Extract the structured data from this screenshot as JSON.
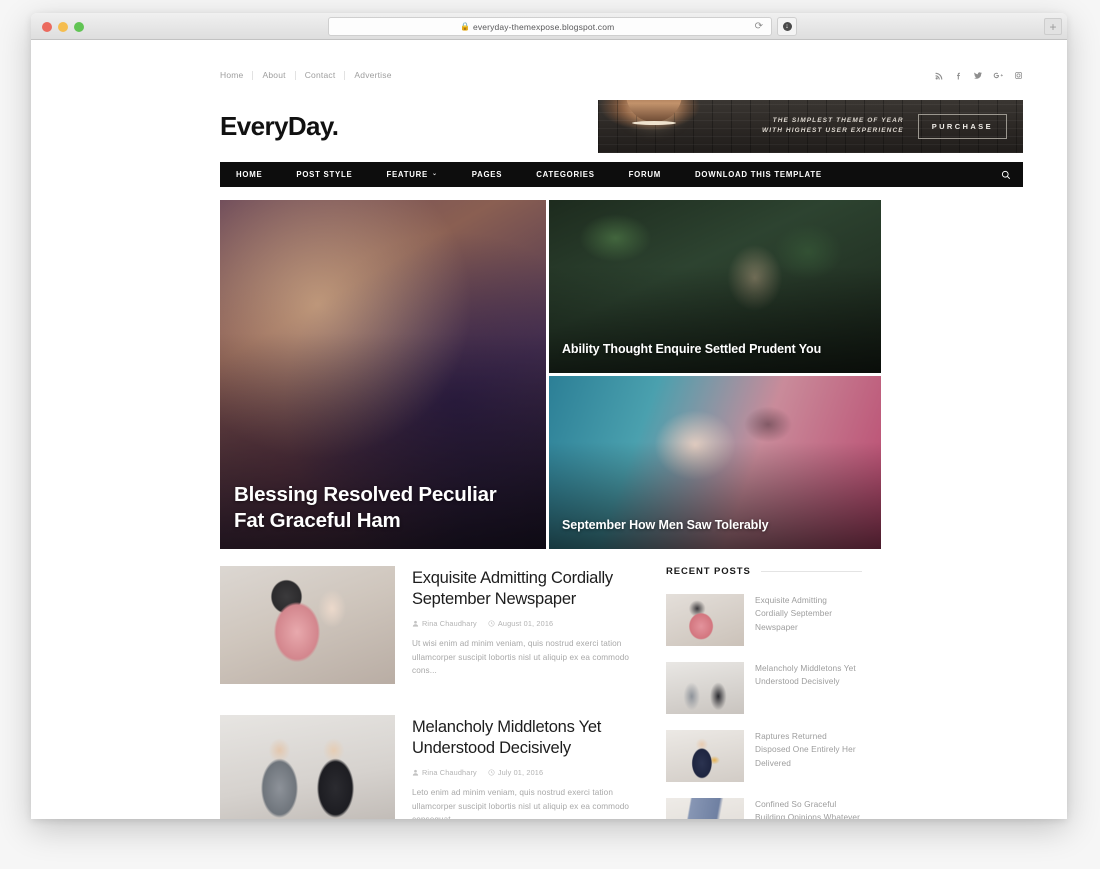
{
  "browser": {
    "url": "everyday-themexpose.blogspot.com",
    "lock_icon": "lock-icon",
    "reload_icon": "reload-icon",
    "newtab_label": "+",
    "download_glyph": "↓"
  },
  "topbar": {
    "links": [
      {
        "label": "Home"
      },
      {
        "label": "About"
      },
      {
        "label": "Contact"
      },
      {
        "label": "Advertise"
      }
    ],
    "social": [
      {
        "name": "rss-icon"
      },
      {
        "name": "facebook-icon"
      },
      {
        "name": "twitter-icon"
      },
      {
        "name": "google-plus-icon"
      },
      {
        "name": "instagram-icon"
      }
    ]
  },
  "header": {
    "logo": "EveryDay.",
    "ad": {
      "line1": "THE SIMPLEST THEME OF YEAR",
      "line2": "WITH HIGHEST USER EXPERIENCE",
      "button": "PURCHASE"
    }
  },
  "mainnav": {
    "items": [
      {
        "label": "HOME",
        "caret": false
      },
      {
        "label": "POST STYLE",
        "caret": false
      },
      {
        "label": "FEATURE",
        "caret": true
      },
      {
        "label": "PAGES",
        "caret": false
      },
      {
        "label": "CATEGORIES",
        "caret": false
      },
      {
        "label": "FORUM",
        "caret": false
      },
      {
        "label": "DOWNLOAD THIS TEMPLATE",
        "caret": false
      }
    ],
    "search_icon": "search-icon",
    "caret_glyph": "⌄"
  },
  "hero": {
    "featured": {
      "title": "Blessing Resolved Peculiar Fat Graceful Ham"
    },
    "top": {
      "title": "Ability Thought Enquire Settled Prudent You"
    },
    "bottom": {
      "title": "September How Men Saw Tolerably"
    }
  },
  "posts": [
    {
      "title": "Exquisite Admitting Cordially September Newspaper",
      "author": "Rina Chaudhary",
      "date": "August 01, 2016",
      "excerpt": "Ut wisi enim ad minim veniam, quis nostrud exerci tation ullamcorper suscipit lobortis nisl ut aliquip ex ea commodo cons..."
    },
    {
      "title": "Melancholy Middletons Yet Understood Decisively",
      "author": "Rina Chaudhary",
      "date": "July 01, 2016",
      "excerpt": "Leto enim ad minim veniam, quis nostrud exerci tation ullamcorper suscipit lobortis nisl ut aliquip ex ea commodo consequat...."
    }
  ],
  "sidebar": {
    "widget_title": "RECENT POSTS",
    "recent_posts": [
      {
        "title": "Exquisite Admitting Cordially September Newspaper"
      },
      {
        "title": "Melancholy Middletons Yet Understood Decisively"
      },
      {
        "title": "Raptures Returned Disposed One Entirely Her Delivered"
      },
      {
        "title": "Confined So Graceful Building Opinions Whatever Trifling"
      }
    ]
  },
  "colors": {
    "nav_bg": "#0d0d0d",
    "page_bg": "#f6f6f6",
    "text_dark": "#1d1d1d",
    "text_muted": "#a8a8a8"
  }
}
